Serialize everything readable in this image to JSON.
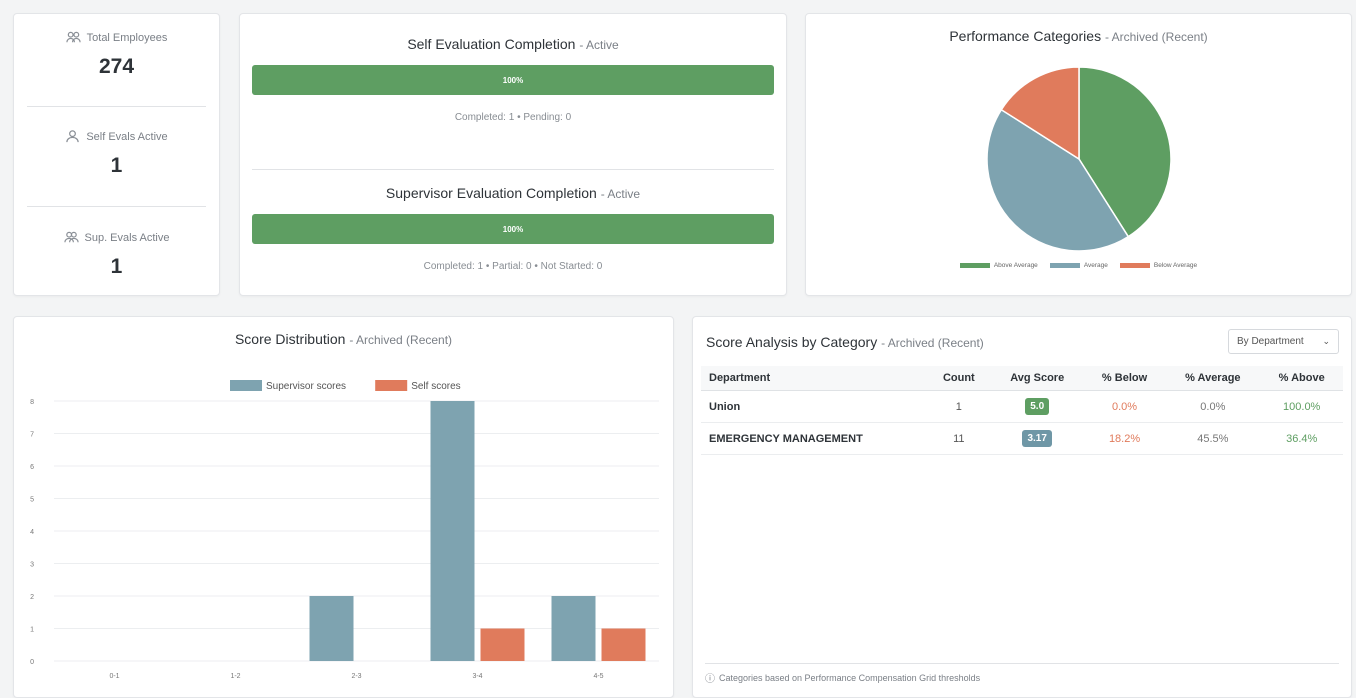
{
  "stats": {
    "total_employees_label": "Total Employees",
    "total_employees_value": "274",
    "self_evals_label": "Self Evals Active",
    "self_evals_value": "1",
    "sup_evals_label": "Sup. Evals Active",
    "sup_evals_value": "1"
  },
  "completion": {
    "self": {
      "title": "Self Evaluation Completion",
      "status": "- Active",
      "progress": 1.0,
      "progress_label": "100%",
      "meta": "Completed: 1 • Pending: 0"
    },
    "supervisor": {
      "title": "Supervisor Evaluation Completion",
      "status": "- Active",
      "progress": 1.0,
      "progress_label": "100%",
      "meta": "Completed: 1 • Partial: 0 • Not Started: 0"
    }
  },
  "pie_card": {
    "title": "Performance Categories",
    "status": "- Archived (Recent)",
    "legend": [
      {
        "label": "Above Average",
        "color": "#5e9e62"
      },
      {
        "label": "Average",
        "color": "#7ea3b0"
      },
      {
        "label": "Below Average",
        "color": "#e07b5c"
      }
    ]
  },
  "bar_card": {
    "title": "Score Distribution",
    "status": "- Archived (Recent)",
    "legend": [
      {
        "label": "Supervisor scores",
        "color": "#7ea3b0"
      },
      {
        "label": "Self scores",
        "color": "#e07b5c"
      }
    ]
  },
  "table_card": {
    "title": "Score Analysis by Category",
    "status": "- Archived (Recent)",
    "select_value": "By Department",
    "columns": [
      "Department",
      "Count",
      "Avg Score",
      "% Below",
      "% Average",
      "% Above"
    ],
    "rows": [
      {
        "department": "Union",
        "count": "1",
        "avg": "5.0",
        "avg_color": "#5e9e62",
        "below": "0.0%",
        "average": "0.0%",
        "above": "100.0%"
      },
      {
        "department": "EMERGENCY MANAGEMENT",
        "count": "11",
        "avg": "3.17",
        "avg_color": "#6f97a6",
        "below": "18.2%",
        "average": "45.5%",
        "above": "36.4%"
      }
    ],
    "footnote": "Categories based on Performance Compensation Grid thresholds"
  },
  "chart_data": [
    {
      "type": "pie",
      "title": "Performance Categories",
      "categories": [
        "Above Average",
        "Average",
        "Below Average"
      ],
      "values": [
        41,
        43,
        16
      ],
      "colors": [
        "#5e9e62",
        "#7ea3b0",
        "#e07b5c"
      ],
      "legend": "bottom"
    },
    {
      "type": "bar",
      "title": "Score Distribution",
      "categories": [
        "0-1",
        "1-2",
        "2-3",
        "3-4",
        "4-5"
      ],
      "series": [
        {
          "name": "Supervisor scores",
          "values": [
            0,
            0,
            2,
            8,
            2
          ],
          "color": "#7ea3b0"
        },
        {
          "name": "Self scores",
          "values": [
            0,
            0,
            0,
            1,
            1
          ],
          "color": "#e07b5c"
        }
      ],
      "ylim": [
        0,
        8
      ],
      "yticks": [
        0,
        1,
        2,
        3,
        4,
        5,
        6,
        7,
        8
      ],
      "grid": true,
      "legend": "top"
    }
  ]
}
